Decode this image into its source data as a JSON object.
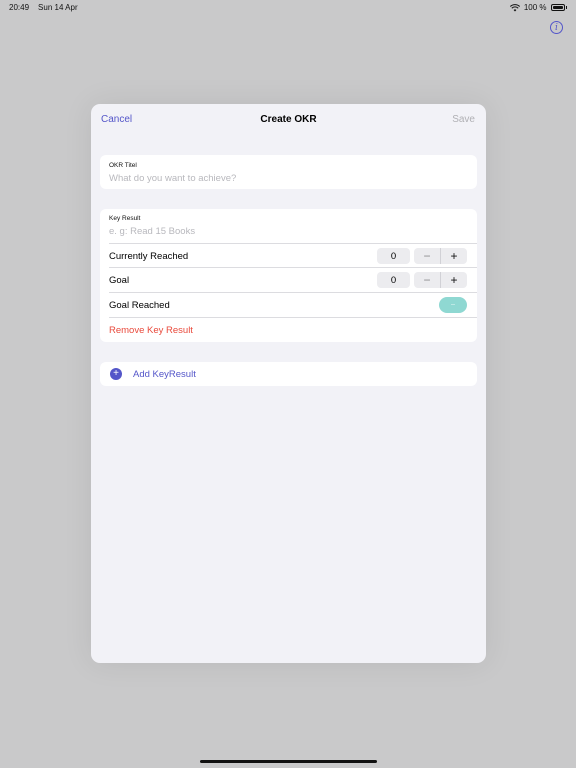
{
  "status_bar": {
    "time": "20:49",
    "date": "Sun 14 Apr",
    "battery": "100 %"
  },
  "nav": {
    "cancel": "Cancel",
    "title": "Create OKR",
    "save": "Save"
  },
  "okr_title": {
    "label": "OKR Titel",
    "placeholder": "What do you want to achieve?"
  },
  "key_result": {
    "label": "Key Result",
    "placeholder": "e. g: Read 15 Books",
    "currently_reached": {
      "label": "Currently Reached",
      "value": "0"
    },
    "goal": {
      "label": "Goal",
      "value": "0"
    },
    "goal_reached": {
      "label": "Goal Reached",
      "toggle_text": "--"
    },
    "remove": "Remove Key Result"
  },
  "stepper": {
    "minus": "−",
    "plus": "+"
  },
  "add_key_result": {
    "icon": "+",
    "label": "Add KeyResult"
  },
  "colors": {
    "accent": "#5456c9",
    "destructive": "#e94a3c",
    "toggle": "#8fd8d2"
  },
  "icons": {
    "info": "info-icon",
    "wifi": "wifi-icon",
    "battery": "battery-icon",
    "add": "plus-circle-icon"
  }
}
